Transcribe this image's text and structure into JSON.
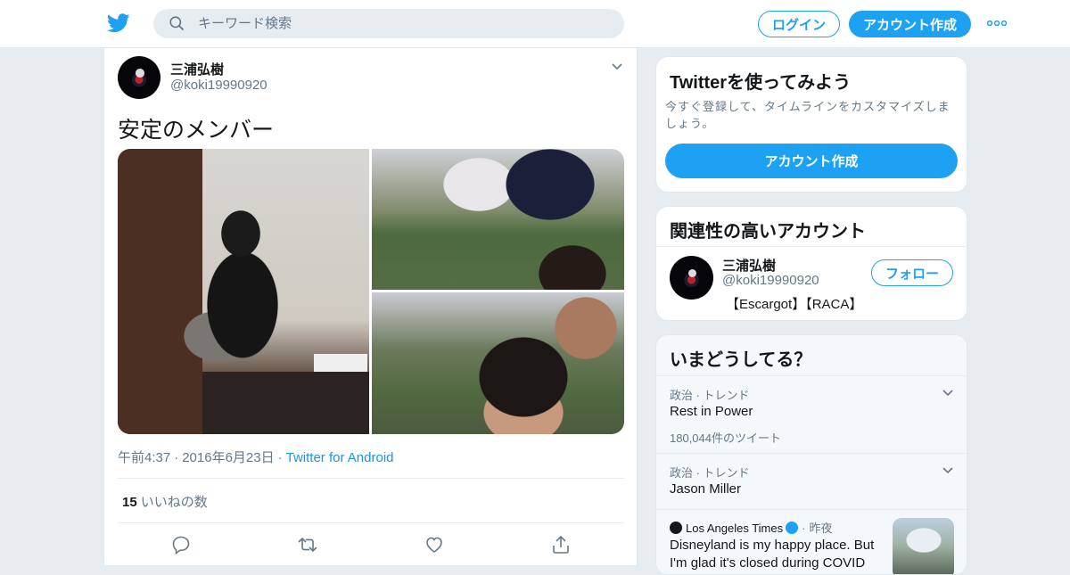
{
  "header": {
    "search_placeholder": "キーワード検索",
    "login_label": "ログイン",
    "signup_label": "アカウント作成"
  },
  "tweet": {
    "name": "三浦弘樹",
    "handle": "@koki19990920",
    "text": "安定のメンバー",
    "time": "午前4:37",
    "date": "2016年6月23日",
    "source": "Twitter for Android",
    "likes_count": "15",
    "likes_label": "いいねの数"
  },
  "signup_box": {
    "title": "Twitterを使ってみよう",
    "text": "今すぐ登録して、タイムラインをカスタマイズしましょう。",
    "button": "アカウント作成"
  },
  "related": {
    "title": "関連性の高いアカウント",
    "name": "三浦弘樹",
    "handle": "@koki19990920",
    "bio": "【Escargot】【RACA】",
    "follow_label": "フォロー"
  },
  "trends": {
    "title": "いまどうしてる？",
    "items": [
      {
        "category": "政治 · トレンド",
        "name": "Rest in Power",
        "count": "180,044件のツイート"
      },
      {
        "category": "政治 · トレンド",
        "name": "Jason Miller"
      }
    ],
    "news": {
      "source": "Los Angeles Times",
      "time": "昨夜",
      "title": "Disneyland is my happy place. But I'm glad it's closed during COVID"
    }
  },
  "colors": {
    "brand": "#1da1f2",
    "link": "#1b95e0",
    "muted": "#657786"
  }
}
